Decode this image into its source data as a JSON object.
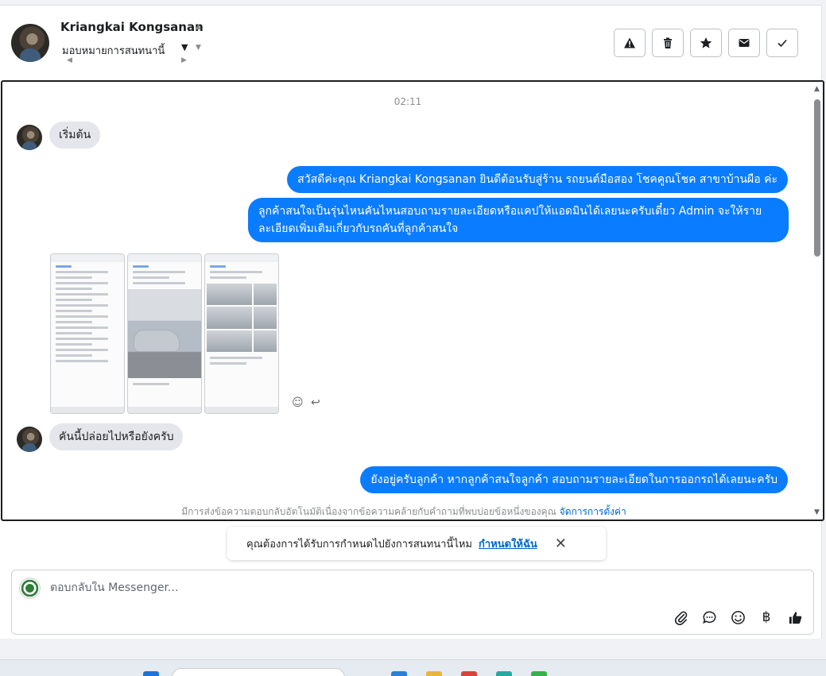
{
  "header": {
    "name": "Kriangkai Kongsanan",
    "assign_label": "มอบหมายการสนทนานี้",
    "actions": [
      {
        "icon": "warning-icon"
      },
      {
        "icon": "trash-icon"
      },
      {
        "icon": "star-icon"
      },
      {
        "icon": "mail-icon"
      },
      {
        "icon": "check-icon"
      }
    ]
  },
  "conversation": {
    "time": "02:11",
    "messages": {
      "m1": "เริ่มต้น",
      "m2": "สวัสดีค่ะคุณ Kriangkai Kongsanan ยินดีต้อนรับสู่ร้าน รถยนต์มือสอง โชคคูณโชค สาขาบ้านผือ ค่ะ",
      "m3": "ลูกค้าสนใจเป็นรุ่นไหนคันไหนสอบถามรายละเอียดหรือแคปให้แอดมินได้เลยนะครับเดี๋ยว Admin จะให้รายละเอียดเพิ่มเติมเกี่ยวกับรถคันที่ลูกค้าสนใจ",
      "m4": "คันนี้ปล่อยไปหรือยังครับ",
      "m5": "ยังอยู่ครับลูกค้า หากลูกค้าสนใจลูกค้า สอบถามรายละเอียดในการออกรถได้เลยนะครับ"
    },
    "auto_reply_note": "มีการส่งข้อความตอบกลับอัตโนมัติเนื่องจากข้อความคล้ายกับคำถามที่พบบ่อยข้อหนึ่งของคุณ",
    "auto_reply_link": "จัดการการตั้งค่า"
  },
  "reminder": {
    "text": "คุณต้องการได้รับการกำหนดไปยังการสนทนานี้ไหม",
    "link": "กำหนดให้ฉัน"
  },
  "composer": {
    "placeholder": "ตอบกลับใน Messenger...",
    "currency_symbol": "฿"
  },
  "colors": {
    "outgoing_bubble": "#0a7cff",
    "incoming_bubble": "#e4e6eb",
    "link": "#0064d1"
  }
}
